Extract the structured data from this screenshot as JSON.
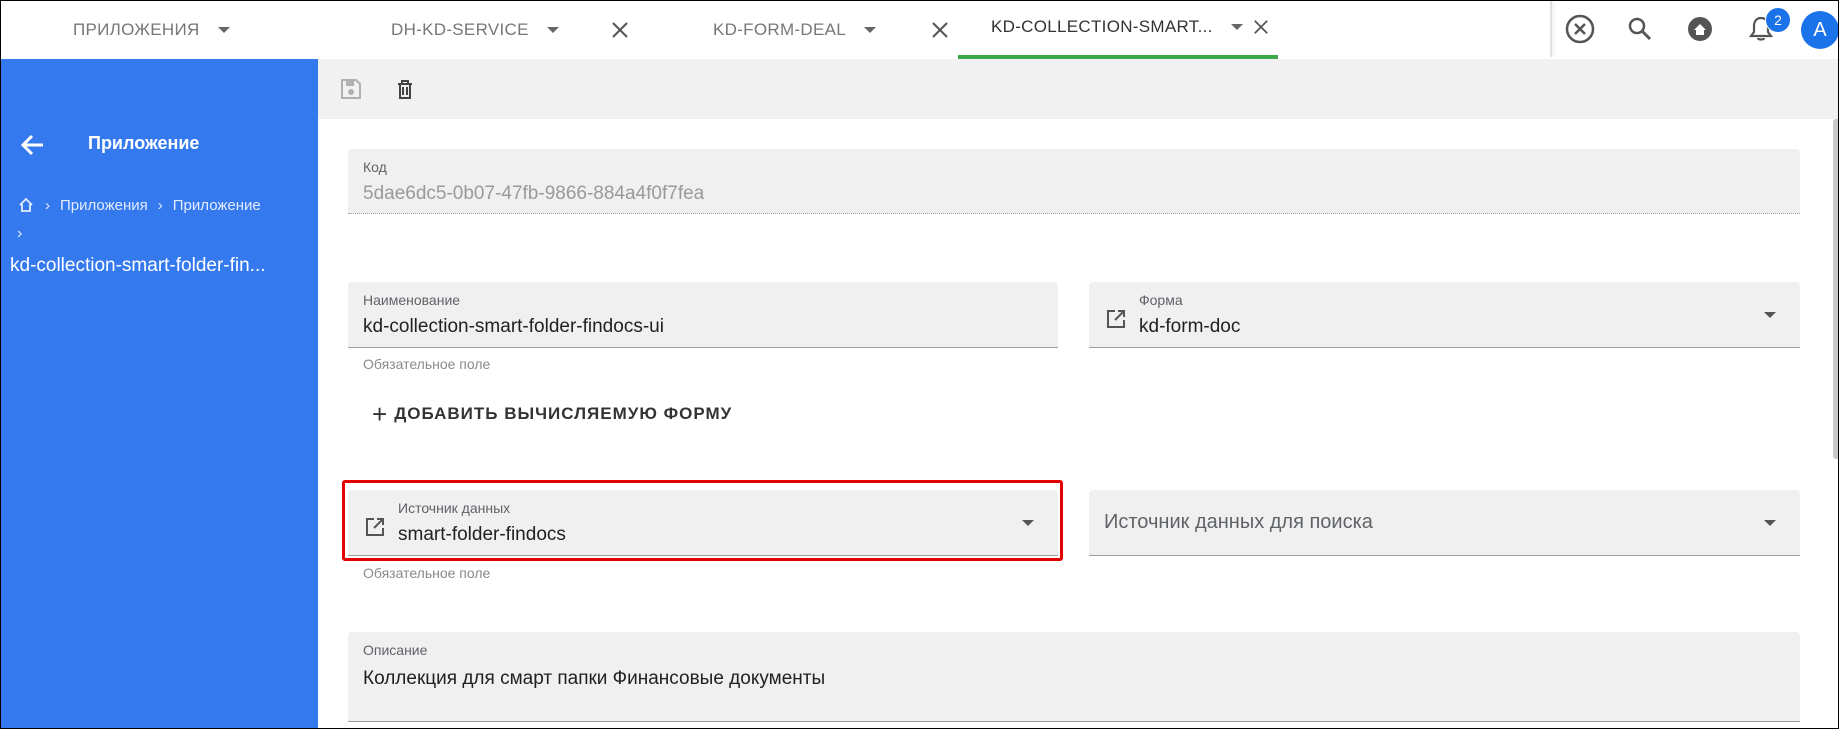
{
  "tabs": [
    {
      "label": "ПРИЛОЖЕНИЯ",
      "closable": false,
      "active": false
    },
    {
      "label": "DH-KD-SERVICE",
      "closable": true,
      "active": false
    },
    {
      "label": "KD-FORM-DEAL",
      "closable": true,
      "active": false
    },
    {
      "label": "KD-COLLECTION-SMART...",
      "closable": true,
      "active": true
    }
  ],
  "topbar": {
    "icons": [
      "close-circle-icon",
      "search-icon",
      "home-icon",
      "bell-icon"
    ],
    "notification_count": "2",
    "avatar_initial": "A"
  },
  "colors": {
    "accent_blue": "#3579ef",
    "active_tab": "#3ca84a",
    "highlight": "#e50000"
  },
  "sidebar": {
    "title": "Приложение",
    "breadcrumbs": [
      "Приложения",
      "Приложение"
    ],
    "current": "kd-collection-smart-folder-fin..."
  },
  "toolbar": {
    "icons": [
      "save-icon",
      "delete-icon"
    ]
  },
  "form": {
    "code": {
      "label": "Код",
      "value": "5dae6dc5-0b07-47fb-9866-884a4f0f7fea"
    },
    "name": {
      "label": "Наименование",
      "value": "kd-collection-smart-folder-findocs-ui",
      "hint": "Обязательное поле"
    },
    "form_select": {
      "label": "Форма",
      "value": "kd-form-doc"
    },
    "add_computed_form": "ДОБАВИТЬ ВЫЧИСЛЯЕМУЮ ФОРМУ",
    "data_source": {
      "label": "Источник данных",
      "value": "smart-folder-findocs",
      "hint": "Обязательное поле"
    },
    "search_source": {
      "placeholder": "Источник данных для поиска"
    },
    "description": {
      "label": "Описание",
      "value": "Коллекция для смарт папки Финансовые документы"
    }
  }
}
